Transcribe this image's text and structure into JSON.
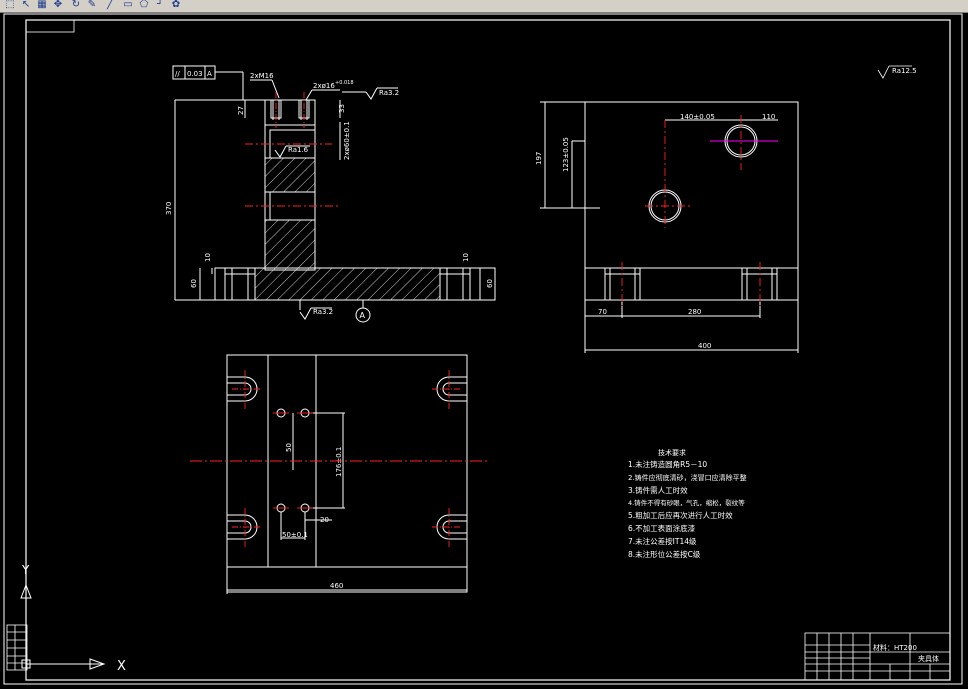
{
  "toolbar": {
    "buttons": [
      {
        "name": "layer-icon",
        "glyph": "⬚"
      },
      {
        "name": "arrow-icon",
        "glyph": "↖"
      },
      {
        "name": "grid-icon",
        "glyph": "▦"
      },
      {
        "name": "move-icon",
        "glyph": "✥"
      },
      {
        "name": "rotate-icon",
        "glyph": "↻"
      },
      {
        "name": "pencil-icon",
        "glyph": "✎"
      },
      {
        "name": "line-icon",
        "glyph": "╱"
      },
      {
        "name": "rect-icon",
        "glyph": "▭"
      },
      {
        "name": "polygon-icon",
        "glyph": "⬠"
      },
      {
        "name": "pointer-icon",
        "glyph": "┘"
      },
      {
        "name": "paint-icon",
        "glyph": "✿"
      }
    ]
  },
  "colors": {
    "background": "#000000",
    "lines": "#ffffff",
    "centerlines": "#ff2020",
    "highlight": "#ff00ff",
    "toolbar": "#d4d0c8"
  },
  "drawing": {
    "front_view": {
      "tolerance_symbol": "//",
      "tolerance_value": "0.03",
      "tolerance_datum": "A",
      "thread_label": "2xM16",
      "hole_label": "2xø16",
      "hole_tol": "+0.018",
      "rough_top": "Ra3.2",
      "rough_inner": "Ra1.6",
      "rough_bottom": "Ra3.2",
      "dim_27": "27",
      "dim_33": "33",
      "dim_height_370": "370",
      "dim_60_left": "60",
      "dim_10_left": "10",
      "dim_10_right": "10",
      "dim_60_right": "60",
      "dim_bore": "2xø60±0.1",
      "datum": "A"
    },
    "side_view": {
      "dim_140": "140±0.05",
      "dim_110": "110",
      "dim_197": "197",
      "dim_123": "123±0.05",
      "dim_70": "70",
      "dim_280": "280",
      "dim_400": "400"
    },
    "top_view": {
      "dim_50": "50",
      "dim_176": "176±0.1",
      "dim_20": "20",
      "dim_50b": "50±0.1",
      "dim_460": "460"
    },
    "general_roughness": "Ra12.5",
    "notes": {
      "title": "技术要求",
      "items": [
        "1.未注铸造圆角R5－10",
        "2.铸件应彻底清砂，浇冒口应清除平整",
        "3.铸件需人工时效",
        "4.铸件不得有砂眼，气孔，缩松，裂纹等",
        "5.粗加工后应再次进行人工时效",
        "6.不加工表面涂底漆",
        "7.未注公差按IT14级",
        "8.未注形位公差按C级"
      ]
    },
    "title_block": {
      "material_label": "材料：HT200",
      "part_name": "夹具体"
    },
    "ucs": {
      "y_label": "Y",
      "x_label": "X"
    }
  }
}
